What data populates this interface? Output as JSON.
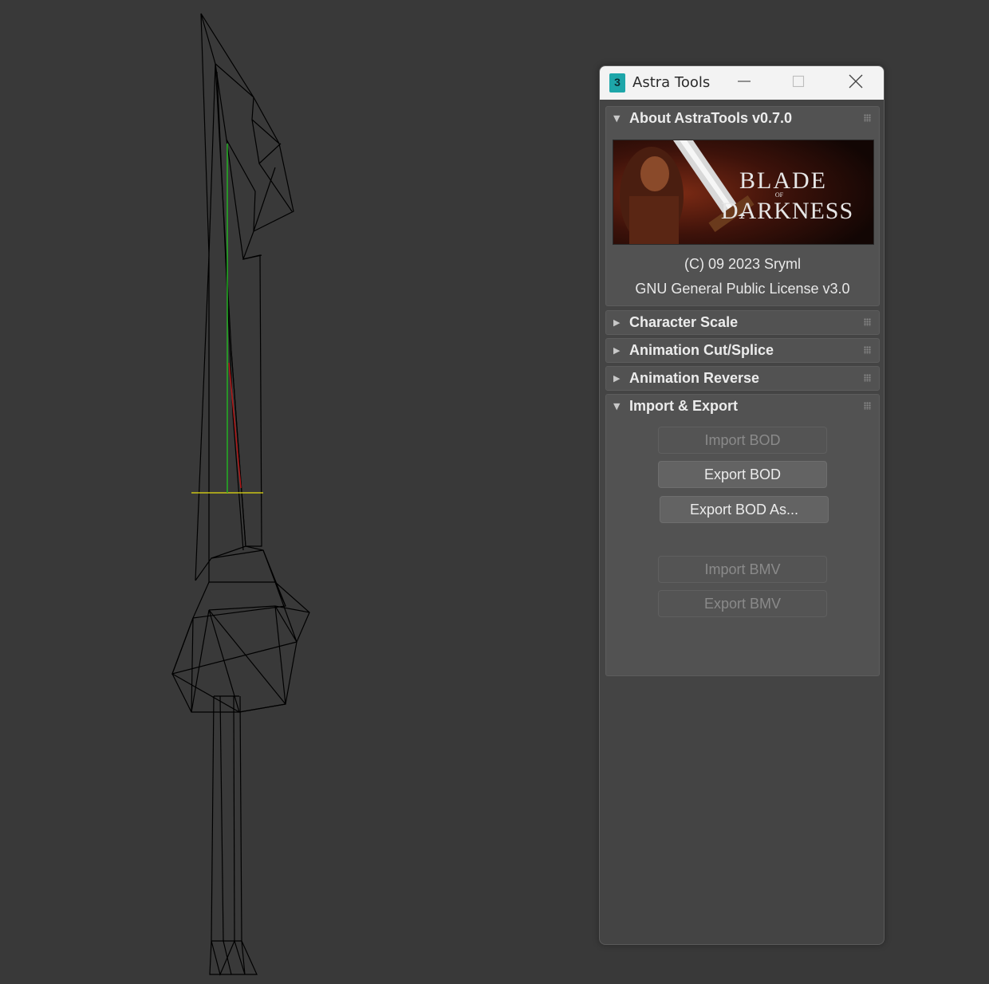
{
  "window": {
    "title": "Astra Tools",
    "app_icon": "3dsmax-icon",
    "controls": [
      "minimize-icon",
      "maximize-icon",
      "close-icon"
    ]
  },
  "banner": {
    "line1": "BLADE",
    "line2": "OF",
    "line3": "DARKNESS"
  },
  "rollouts": {
    "about": {
      "title": "About AstraTools v0.7.0",
      "expanded": true,
      "copyright": "(C) 09 2023 Sryml",
      "license": "GNU General Public License v3.0"
    },
    "character_scale": {
      "title": "Character Scale",
      "expanded": false
    },
    "anim_cut_splice": {
      "title": "Animation Cut/Splice",
      "expanded": false
    },
    "anim_reverse": {
      "title": "Animation Reverse",
      "expanded": false
    },
    "import_export": {
      "title": "Import & Export",
      "expanded": true,
      "buttons": {
        "import_bod": "Import BOD",
        "export_bod": "Export BOD",
        "export_bod_as": "Export BOD As...",
        "import_bmv": "Import BMV",
        "export_bmv": "Export BMV"
      }
    }
  },
  "colors": {
    "viewport_bg": "#393939",
    "panel_bg": "#444444",
    "rollout_bg": "#525252",
    "wire": "#000000",
    "axis_y": "#22b022",
    "axis_x": "#b01818",
    "ground": "#e8e010"
  }
}
